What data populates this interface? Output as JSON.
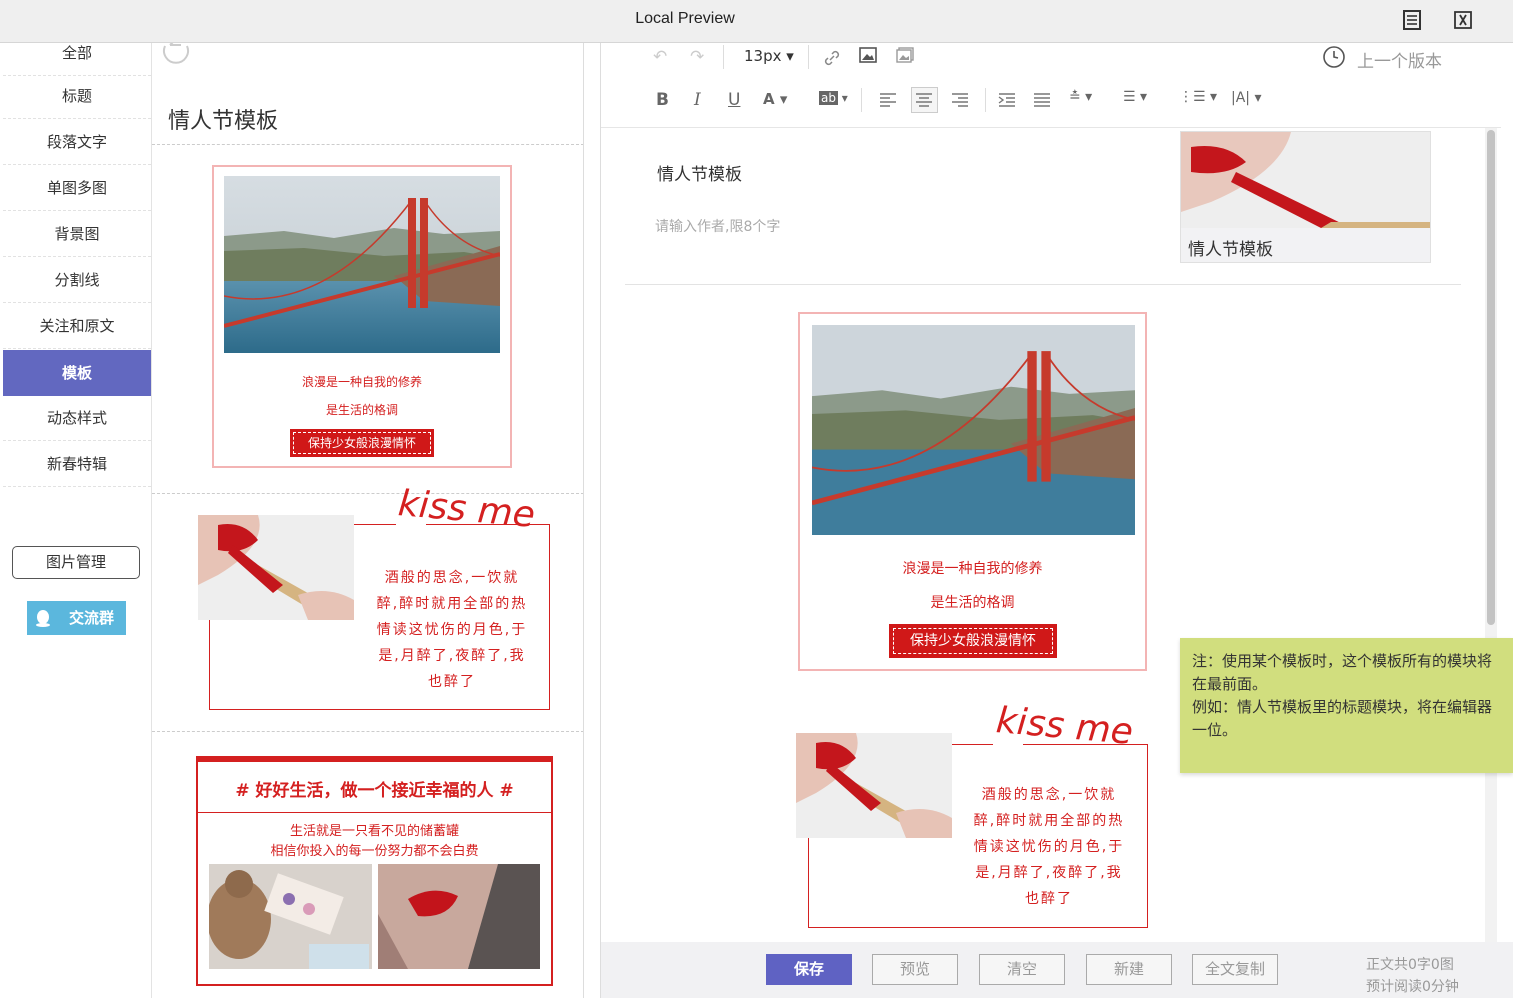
{
  "window": {
    "title": "Local Preview"
  },
  "sidebar": {
    "items": [
      {
        "label": "全部"
      },
      {
        "label": "标题"
      },
      {
        "label": "段落文字"
      },
      {
        "label": "单图多图"
      },
      {
        "label": "背景图"
      },
      {
        "label": "分割线"
      },
      {
        "label": "关注和原文"
      },
      {
        "label": "模板"
      },
      {
        "label": "动态样式"
      },
      {
        "label": "新春特辑"
      }
    ],
    "active_index": 7,
    "image_manage_label": "图片管理",
    "group_label": "交流群"
  },
  "templates": {
    "heading": "情人节模板",
    "card1": {
      "line1": "浪漫是一种自我的修养",
      "line2": "是生活的格调",
      "button": "保持少女般浪漫情怀"
    },
    "card2": {
      "kiss": "kiss me",
      "poem": [
        "酒般的思念,一饮就",
        "醉,醉时就用全部的热",
        "情读这忧伤的月色,于",
        "是,月醉了,夜醉了,我",
        "也醉了"
      ]
    },
    "card3": {
      "title": "# 好好生活，做一个接近幸福的人 #",
      "line1": "生活就是一只看不见的储蓄罐",
      "line2": "相信你投入的每一份努力都不会白费"
    }
  },
  "editor": {
    "font_size": "13px",
    "version_label": "上一个版本",
    "article_title": "情人节模板",
    "author_placeholder": "请输入作者,限8个字",
    "cover_caption": "情人节模板",
    "buttons": {
      "save": "保存",
      "preview": "预览",
      "clear": "清空",
      "new": "新建",
      "copy_all": "全文复制"
    },
    "stats_line1": "正文共0字0图",
    "stats_line2": "预计阅读0分钟"
  },
  "note": {
    "line1": "注：使用某个模板时，这个模板所有的模块将",
    "line2": "在最前面。",
    "line3": "例如：情人节模板里的标题模块，将在编辑器",
    "line4": "一位。"
  },
  "colors": {
    "accent": "#6268c0",
    "template_red": "#d42020",
    "note_bg": "#d1de7e",
    "group_btn": "#5bb7dd"
  }
}
